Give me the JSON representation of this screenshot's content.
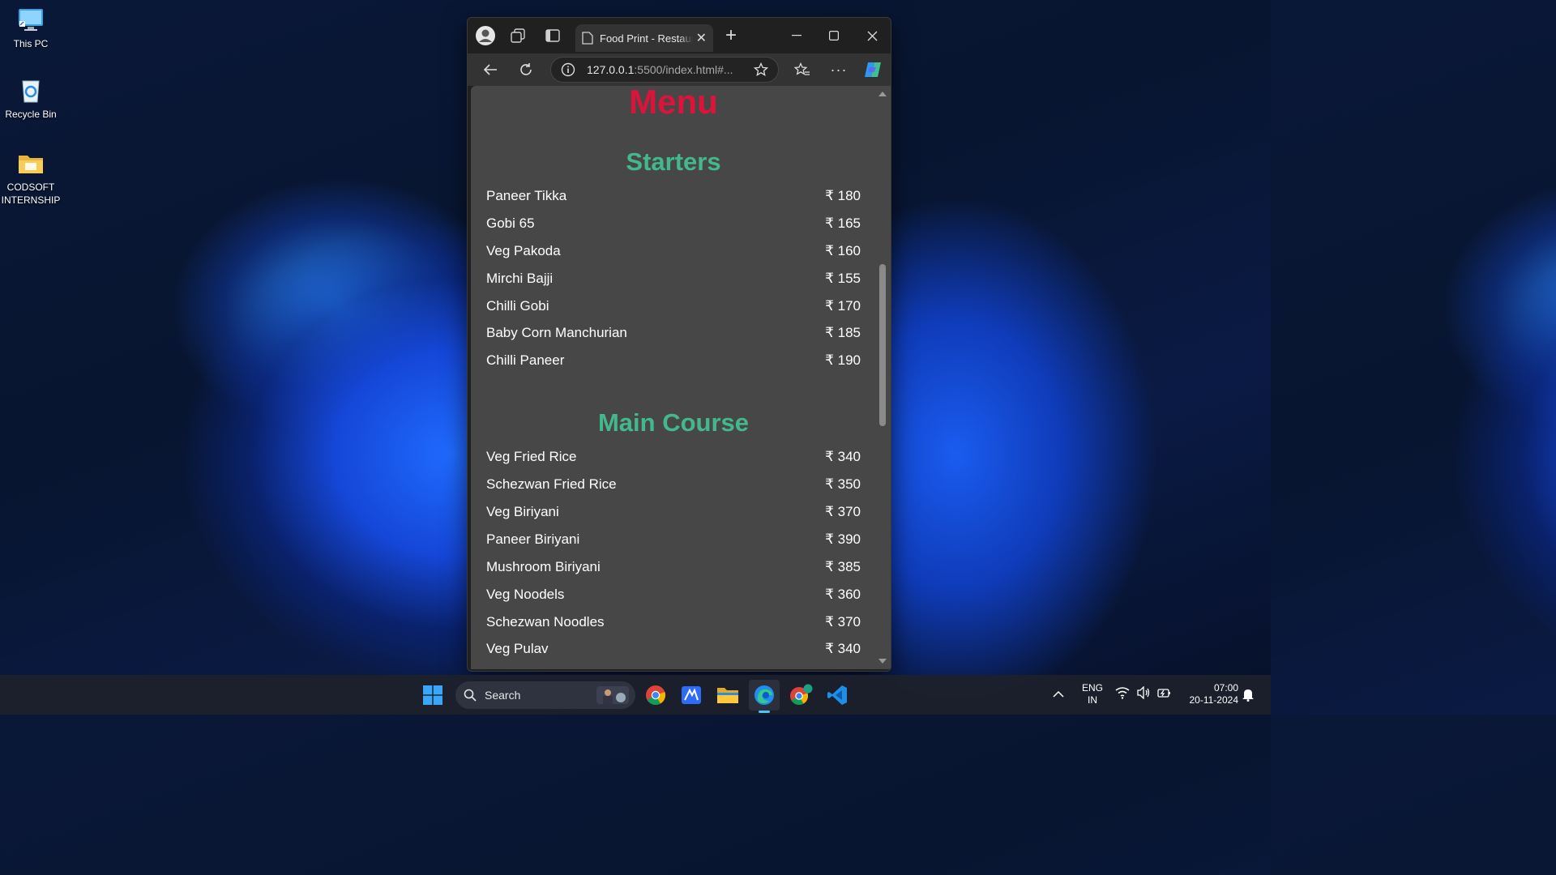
{
  "desktop": {
    "icons": [
      {
        "label": "This PC"
      },
      {
        "label": "Recycle Bin"
      },
      {
        "label": "CODSOFT INTERNSHIP"
      }
    ]
  },
  "browser": {
    "tab_title": "Food Print - Restaurant",
    "url_main": "127.0.0.1",
    "url_dim": ":5500/index.html#..."
  },
  "page": {
    "menu_title": "Menu",
    "sections": [
      {
        "title": "Starters",
        "items": [
          {
            "name": "Paneer Tikka",
            "price": "₹ 180"
          },
          {
            "name": "Gobi 65",
            "price": "₹ 165"
          },
          {
            "name": "Veg Pakoda",
            "price": "₹ 160"
          },
          {
            "name": "Mirchi Bajji",
            "price": "₹ 155"
          },
          {
            "name": "Chilli Gobi",
            "price": "₹ 170"
          },
          {
            "name": "Baby Corn Manchurian",
            "price": "₹ 185"
          },
          {
            "name": "Chilli Paneer",
            "price": "₹ 190"
          }
        ]
      },
      {
        "title": "Main Course",
        "items": [
          {
            "name": "Veg Fried Rice",
            "price": "₹ 340"
          },
          {
            "name": "Schezwan Fried Rice",
            "price": "₹ 350"
          },
          {
            "name": "Veg Biriyani",
            "price": "₹ 370"
          },
          {
            "name": "Paneer Biriyani",
            "price": "₹ 390"
          },
          {
            "name": "Mushroom Biriyani",
            "price": "₹ 385"
          },
          {
            "name": "Veg Noodels",
            "price": "₹ 360"
          },
          {
            "name": "Schezwan Noodles",
            "price": "₹ 370"
          },
          {
            "name": "Veg Pulav",
            "price": "₹ 340"
          }
        ]
      }
    ]
  },
  "taskbar": {
    "search_label": "Search",
    "lang_top": "ENG",
    "lang_bottom": "IN",
    "time": "07:00",
    "date": "20-11-2024"
  },
  "colors": {
    "menu_title": "#dc143c",
    "section_title": "#43b88c",
    "page_bg": "#474747"
  }
}
